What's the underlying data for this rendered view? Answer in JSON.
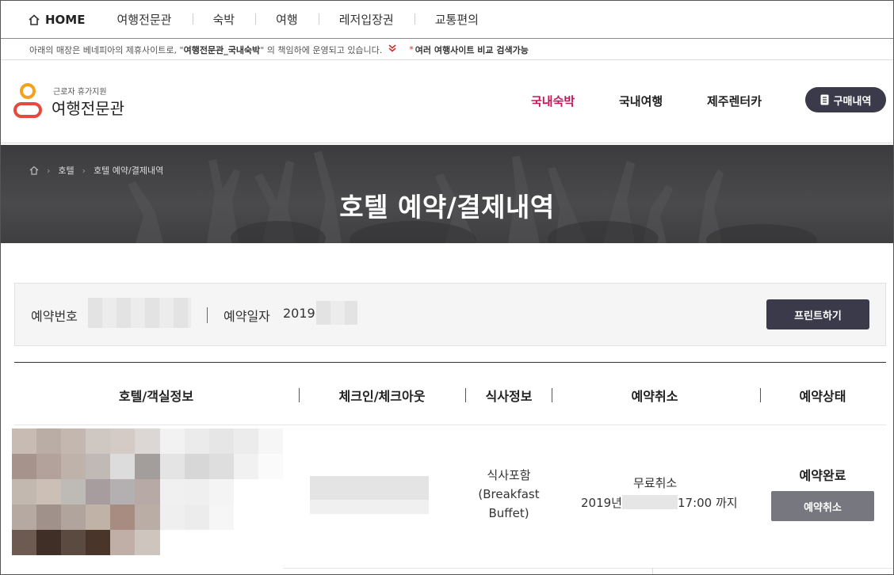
{
  "topnav": {
    "home": "HOME",
    "items": [
      "여행전문관",
      "숙박",
      "여행",
      "레저입장권",
      "교통편의"
    ]
  },
  "notice": {
    "text1": "아래의 매장은 베네피아의 제휴사이트로, \"",
    "bold": "여행전문관_국내숙박",
    "text2": "\" 의 책임하에 운영되고 있습니다.",
    "chevron": "⌄",
    "star": "*",
    "compare": "여러 여행사이트 비교 검색가능"
  },
  "brand": {
    "sub": "근로자 휴가지원",
    "name": "여행전문관",
    "menu": [
      "국내숙박",
      "국내여행",
      "제주렌터카"
    ],
    "buy_label": "구매내역"
  },
  "banner": {
    "breadcrumb": [
      "호텔",
      "호텔 예약/결제내역"
    ],
    "title": "호텔 예약/결제내역"
  },
  "reservation": {
    "number_label": "예약번호",
    "date_label": "예약일자",
    "date_value": "2019.",
    "print_label": "프린트하기"
  },
  "table": {
    "headers": [
      "호텔/객실정보",
      "체크인/체크아웃",
      "식사정보",
      "예약취소",
      "예약상태"
    ],
    "row": {
      "meal": [
        "식사포함",
        "(Breakfast",
        "Buffet)"
      ],
      "cancel_line1": "무료취소",
      "cancel_year": "2019년",
      "cancel_time": "17:00 까지",
      "status": "예약완료",
      "cancel_button": "예약취소"
    }
  },
  "colors": {
    "accent": "#c2185b",
    "button_dark": "#3a3a4a",
    "button_gray": "#77777f",
    "logo_orange": "#f4a21c",
    "logo_red": "#e44b3c"
  }
}
